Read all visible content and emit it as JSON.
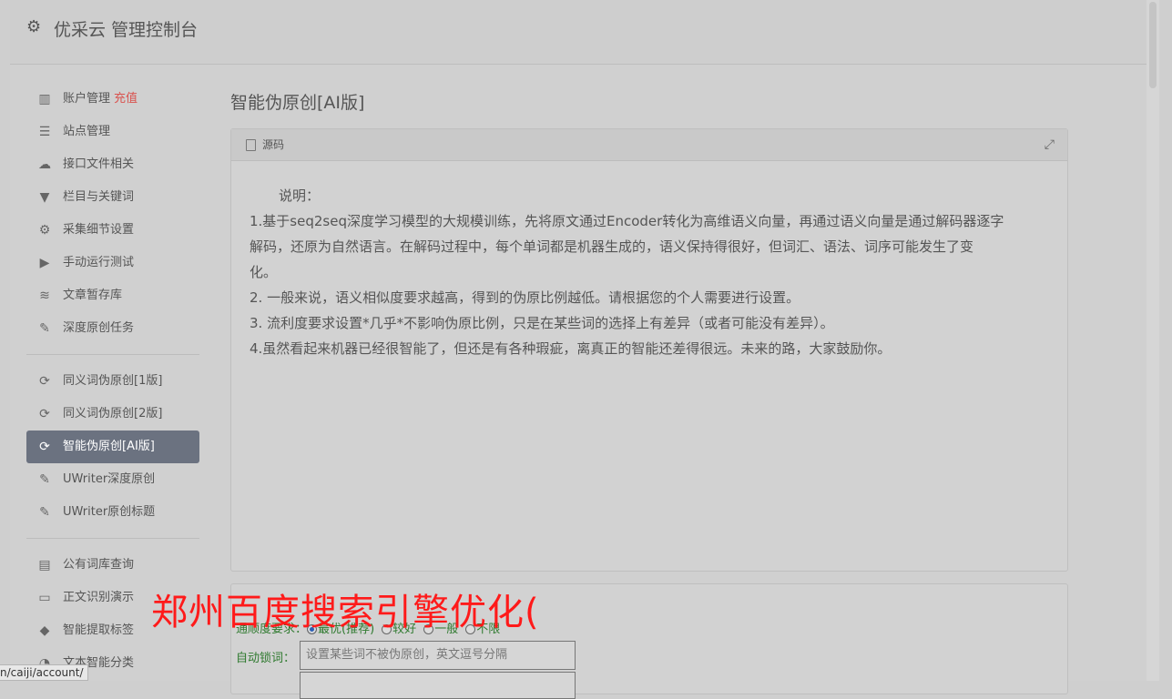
{
  "header": {
    "title": "优采云 管理控制台"
  },
  "sidebar": {
    "group1": [
      {
        "label": "账户管理",
        "badge": "充值",
        "icon": "bar-chart-icon"
      },
      {
        "label": "站点管理",
        "icon": "server-icon"
      },
      {
        "label": "接口文件相关",
        "icon": "cloud-upload-icon"
      },
      {
        "label": "栏目与关键词",
        "icon": "filter-icon"
      },
      {
        "label": "采集细节设置",
        "icon": "gears-icon"
      },
      {
        "label": "手动运行测试",
        "icon": "play-icon"
      },
      {
        "label": "文章暂存库",
        "icon": "database-icon"
      },
      {
        "label": "深度原创任务",
        "icon": "edit-icon"
      }
    ],
    "group2": [
      {
        "label": "同义词伪原创[1版]",
        "icon": "refresh-icon"
      },
      {
        "label": "同义词伪原创[2版]",
        "icon": "refresh-icon"
      },
      {
        "label": "智能伪原创[AI版]",
        "icon": "refresh-icon",
        "active": true
      },
      {
        "label": "UWriter深度原创",
        "icon": "edit-icon"
      },
      {
        "label": "UWriter原创标题",
        "icon": "edit-icon"
      }
    ],
    "group3": [
      {
        "label": "公有词库查询",
        "icon": "book-icon"
      },
      {
        "label": "正文识别演示",
        "icon": "monitor-icon"
      },
      {
        "label": "智能提取标签",
        "icon": "tag-icon"
      },
      {
        "label": "文本智能分类",
        "icon": "pie-chart-icon"
      }
    ]
  },
  "main": {
    "title": "智能伪原创[AI版]",
    "panel": {
      "heading": "源码",
      "intro": "说明：",
      "lines": [
        "1.基于seq2seq深度学习模型的大规模训练，先将原文通过Encoder转化为高维语义向量，再通过语义向量是通过解码器逐字",
        "解码，还原为自然语言。在解码过程中，每个单词都是机器生成的，语义保持得很好，但词汇、语法、词序可能发生了变",
        "化。",
        "2. 一般来说，语义相似度要求越高，得到的伪原比例越低。请根据您的个人需要进行设置。",
        "3. 流利度要求设置*几乎*不影响伪原比例，只是在某些词的选择上有差异（或者可能没有差异）。",
        "4.虽然看起来机器已经很智能了，但还是有各种瑕疵，离真正的智能还差得很远。未来的路，大家鼓励你。"
      ]
    },
    "form": {
      "fluency_label": "通顺度要求：",
      "fluency_options": [
        "最优(推荐)",
        "较好",
        "一般",
        "不限"
      ],
      "lock_label": "自动锁词：",
      "lock_placeholder": "设置某些词不被伪原创，英文逗号分隔"
    }
  },
  "overlay": {
    "text": "郑州百度搜索引擎优化("
  },
  "status": {
    "url": "n/caiji/account/"
  }
}
